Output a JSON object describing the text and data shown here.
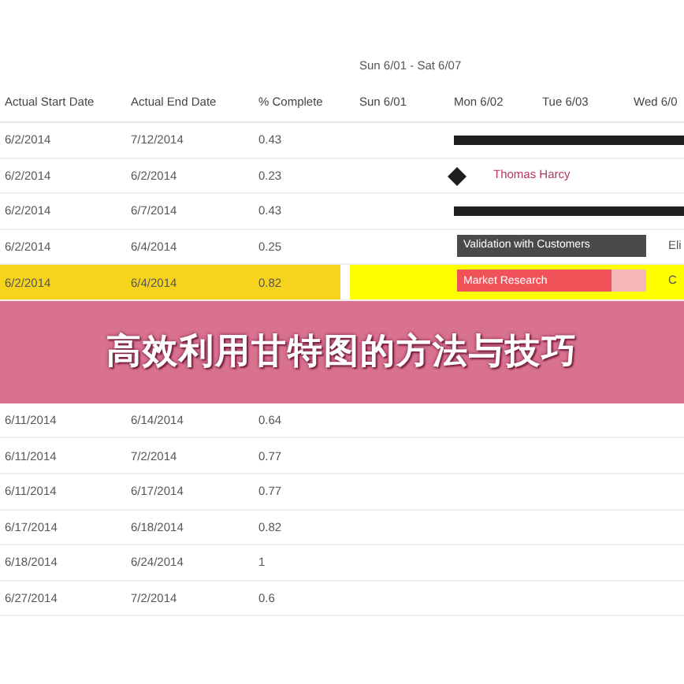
{
  "week_label": "Sun 6/01 - Sat 6/07",
  "columns": [
    "Actual Start Date",
    "Actual End Date",
    "% Complete"
  ],
  "days": [
    "Sun 6/01",
    "Mon 6/02",
    "Tue 6/03",
    "Wed 6/0"
  ],
  "rows": [
    {
      "cells": [
        "6/2/2014",
        "7/12/2014",
        "0.43"
      ],
      "selected": false,
      "task": {
        "kind": "summary"
      }
    },
    {
      "cells": [
        "6/2/2014",
        "6/2/2014",
        "0.23"
      ],
      "selected": false,
      "task": {
        "kind": "milestone",
        "label": "Thomas Harcy"
      }
    },
    {
      "cells": [
        "6/2/2014",
        "6/7/2014",
        "0.43"
      ],
      "selected": false,
      "task": {
        "kind": "summary"
      }
    },
    {
      "cells": [
        "6/2/2014",
        "6/4/2014",
        "0.25"
      ],
      "selected": false,
      "task": {
        "kind": "task",
        "label": "Validation with Customers",
        "color": "#4a4a4a",
        "level": 1,
        "side_label": "Eli"
      }
    },
    {
      "cells": [
        "6/2/2014",
        "6/4/2014",
        "0.82"
      ],
      "selected": true,
      "task": {
        "kind": "task",
        "label": "Market Research",
        "color": "#f0525a",
        "level": 0.82,
        "side_label": "C"
      }
    },
    {
      "kind": "banner",
      "title": "高效利用甘特图的方法与技巧"
    },
    {
      "cells": [
        "6/11/2014",
        "6/14/2014",
        "0.64"
      ],
      "selected": false
    },
    {
      "cells": [
        "6/11/2014",
        "7/2/2014",
        "0.77"
      ],
      "selected": false
    },
    {
      "cells": [
        "6/11/2014",
        "6/17/2014",
        "0.77"
      ],
      "selected": false
    },
    {
      "cells": [
        "6/17/2014",
        "6/18/2014",
        "0.82"
      ],
      "selected": false
    },
    {
      "cells": [
        "6/18/2014",
        "6/24/2014",
        "1"
      ],
      "selected": false
    },
    {
      "cells": [
        "6/27/2014",
        "7/2/2014",
        "0.6"
      ],
      "selected": false
    }
  ]
}
